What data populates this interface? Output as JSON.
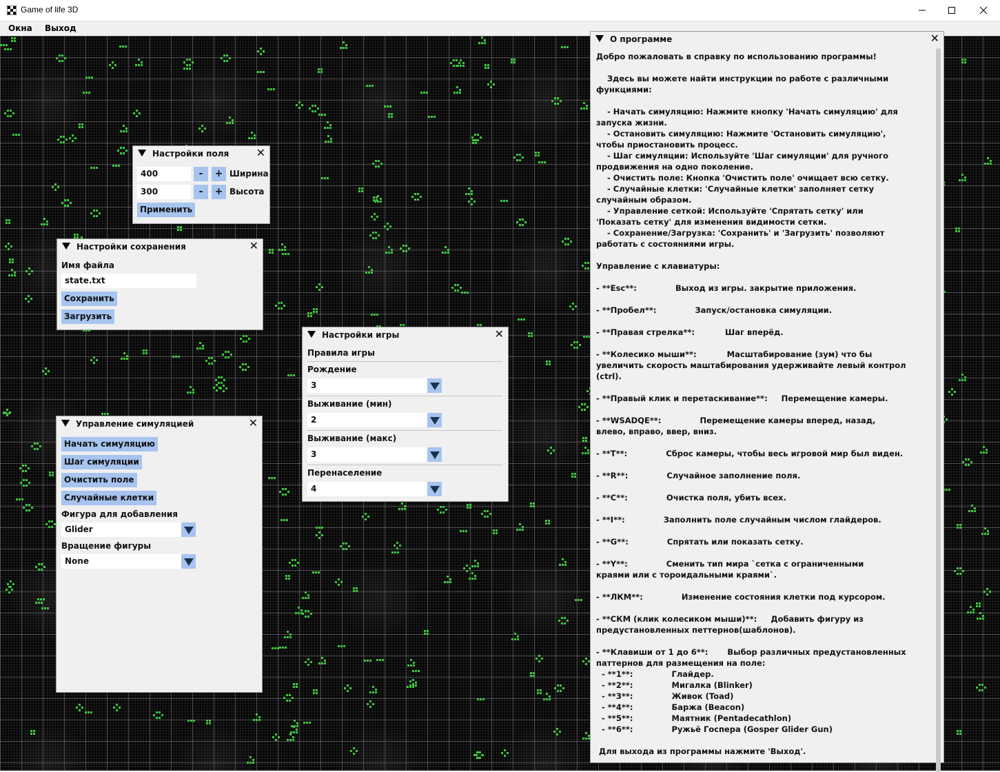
{
  "window": {
    "title": "Game of life 3D",
    "icon": "checker-app-icon",
    "controls": [
      "minimize-icon",
      "maximize-icon",
      "close-icon"
    ]
  },
  "menu": {
    "items": [
      "Окна",
      "Выход"
    ]
  },
  "colors": {
    "cell": "#3ec83e",
    "panel_bg": "#f0f0f0",
    "button": "#a6c4ef",
    "viewport_bg": "#050505"
  },
  "field_settings": {
    "title": "Настройки поля",
    "width_value": "400",
    "height_value": "300",
    "minus": "-",
    "plus": "+",
    "width_label": "Ширина",
    "height_label": "Высота",
    "apply": "Применить"
  },
  "save_settings": {
    "title": "Настройки сохранения",
    "filename_label": "Имя файла",
    "filename_value": "state.txt",
    "save": "Сохранить",
    "load": "Загрузить"
  },
  "game_settings": {
    "title": "Настройки игры",
    "rules_label": "Правила игры",
    "birth_label": "Рождение",
    "birth_value": "3",
    "survive_min_label": "Выживание (мин)",
    "survive_min_value": "2",
    "survive_max_label": "Выживание (макс)",
    "survive_max_value": "3",
    "overpop_label": "Перенаселение",
    "overpop_value": "4"
  },
  "sim_control": {
    "title": "Управление симуляцией",
    "start": "Начать симуляцию",
    "step": "Шаг симуляции",
    "clear": "Очистить поле",
    "random": "Случайные клетки",
    "figure_label": "Фигура для добавления",
    "figure_value": "Glider",
    "rotation_label": "Вращение фигуры",
    "rotation_value": "None"
  },
  "about": {
    "title": "О программе",
    "text": "Добро пожаловать в справку по использованию программы!\n\n    Здесь вы можете найти инструкции по работе с различными\nфункциями:\n\n    - Начать симуляцию: Нажмите кнопку 'Начать симуляцию' для\nзапуска жизни.\n    - Остановить симуляцию: Нажмите 'Остановить симуляцию',\nчтобы приостановить процесс.\n    - Шаг симуляции: Используйте 'Шаг симуляции' для ручного\nпродвижения на одно поколение.\n    - Очистить поле: Кнопка 'Очистить поле' очищает всю сетку.\n    - Случайные клетки: 'Случайные клетки' заполняет сетку\nслучайным образом.\n    - Управление сеткой: Используйте 'Спрятать сетку' или\n'Показать сетку' для изменения видимости сетки.\n    - Сохранение/Загрузка: 'Сохранить' и 'Загрузить' позволяют\nработать с состояниями игры.\n\nУправление с клавиатуры:\n\n- **Esc**:              Выход из игры. закрытие приложения.\n\n- **Пробел**:              Запуск/остановка симуляции.\n\n- **Правая стрелка**:           Шаг вперёд.\n\n- **Колесико мыши**:           Масштабирование (зум) что бы\nувеличить скорость маштабирования удерживайте левый контрол\n(ctrl).\n\n- **Правый клик и перетаскивание**:     Перемещение камеры.\n\n- **WSADQE**:              Перемещение камеры вперед, назад,\nвлево, вправо, ввер, вниз.\n\n- **T**:              Сброс камеры, чтобы весь игровой мир был виден.\n\n- **R**:              Случайное заполнение поля.\n\n- **C**:              Очистка поля, убить всех.\n\n- **I**:              Заполнить поле случайным числом глайдеров.\n\n- **G**:              Спрятать или показать сетку.\n\n- **Y**:              Сменить тип мира `сетка с ограниченными\nкраями или с тороидальными краями`.\n\n- **ЛКМ**:              Изменение состояния клетки под курсором.\n\n- **СКМ (клик колесиком мыши)**:     Добавить фигуру из\nпредустановленных петтернов(шаблонов).\n\n- **Клавиши от 1 до 6**:       Выбор различных предустановленных\nпаттернов для размещения на поле:\n  - **1**:              Глайдер.\n  - **2**:              Мигалка (Blinker)\n  - **3**:              Живок (Toad)\n  - **4**:              Баржа (Beacon)\n  - **5**:              Маятник (Pentadecathlon)\n  - **6**:              Ружьё Госпера (Gosper Glider Gun)\n\n Для выхода из программы нажмите 'Выход'."
  }
}
